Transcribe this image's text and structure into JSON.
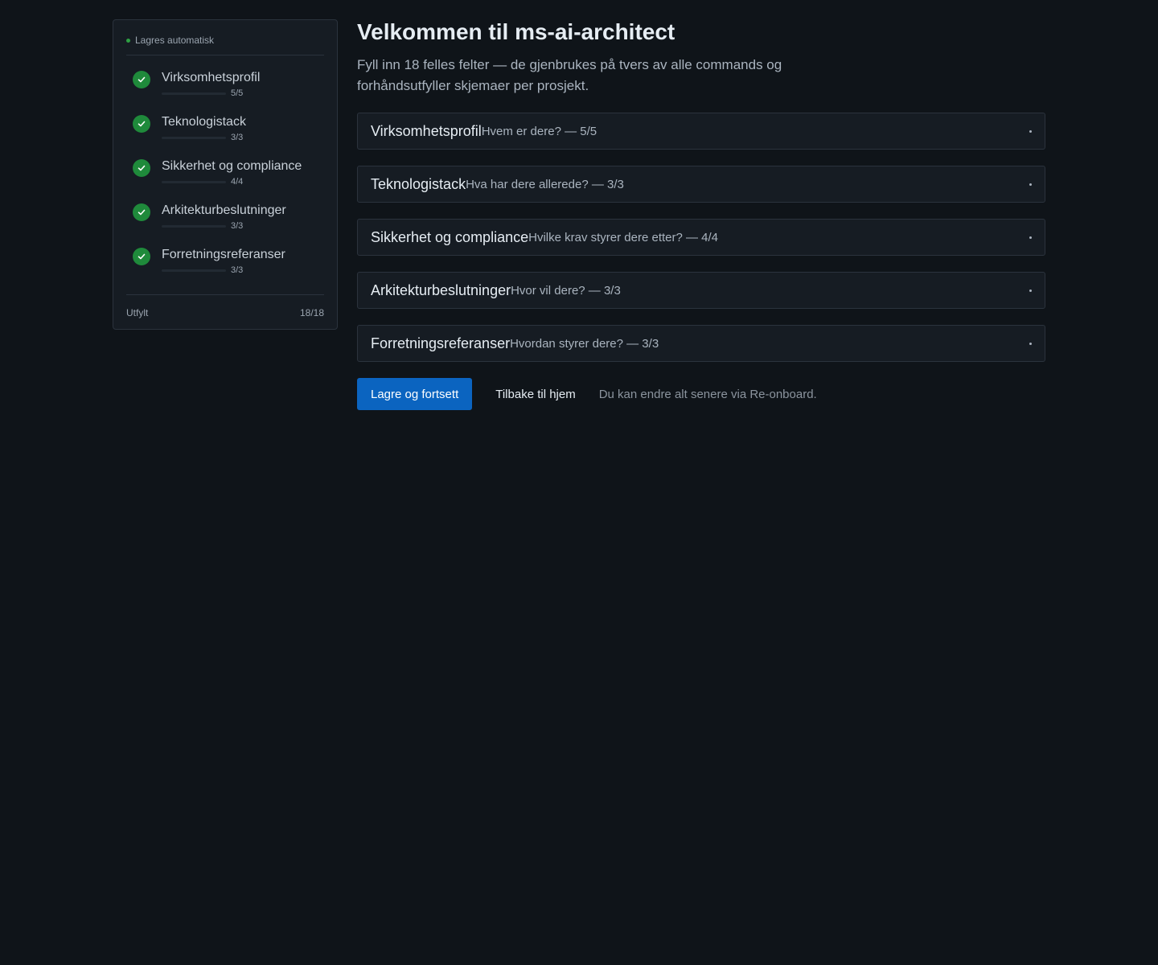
{
  "sidebar": {
    "autosave_label": "Lagres automatisk",
    "steps": [
      {
        "label": "Virksomhetsprofil",
        "count": "5/5",
        "progress": 1.0
      },
      {
        "label": "Teknologistack",
        "count": "3/3",
        "progress": 1.0
      },
      {
        "label": "Sikkerhet og compliance",
        "count": "4/4",
        "progress": 1.0
      },
      {
        "label": "Arkitekturbeslutninger",
        "count": "3/3",
        "progress": 1.0
      },
      {
        "label": "Forretningsreferanser",
        "count": "3/3",
        "progress": 1.0
      }
    ],
    "footer_label": "Utfylt",
    "footer_count": "18/18"
  },
  "main": {
    "title": "Velkommen til ms-ai-architect",
    "subtitle": "Fyll inn 18 felles felter — de gjenbrukes på tvers av alle commands og forhåndsutfyller skjemaer per prosjekt.",
    "sections": [
      {
        "title": "Virksomhetsprofil",
        "desc": "Hvem er dere? — 5/5"
      },
      {
        "title": "Teknologistack",
        "desc": "Hva har dere allerede? — 3/3"
      },
      {
        "title": "Sikkerhet og compliance",
        "desc": "Hvilke krav styrer dere etter? — 4/4"
      },
      {
        "title": "Arkitekturbeslutninger",
        "desc": "Hvor vil dere? — 3/3"
      },
      {
        "title": "Forretningsreferanser",
        "desc": "Hvordan styrer dere? — 3/3"
      }
    ],
    "save_button": "Lagre og fortsett",
    "back_button": "Tilbake til hjem",
    "hint": "Du kan endre alt senere via Re-onboard."
  },
  "colors": {
    "background": "#0f1419",
    "panel": "#161c23",
    "accent": "#0b64c0",
    "success": "#1f8a3b"
  }
}
